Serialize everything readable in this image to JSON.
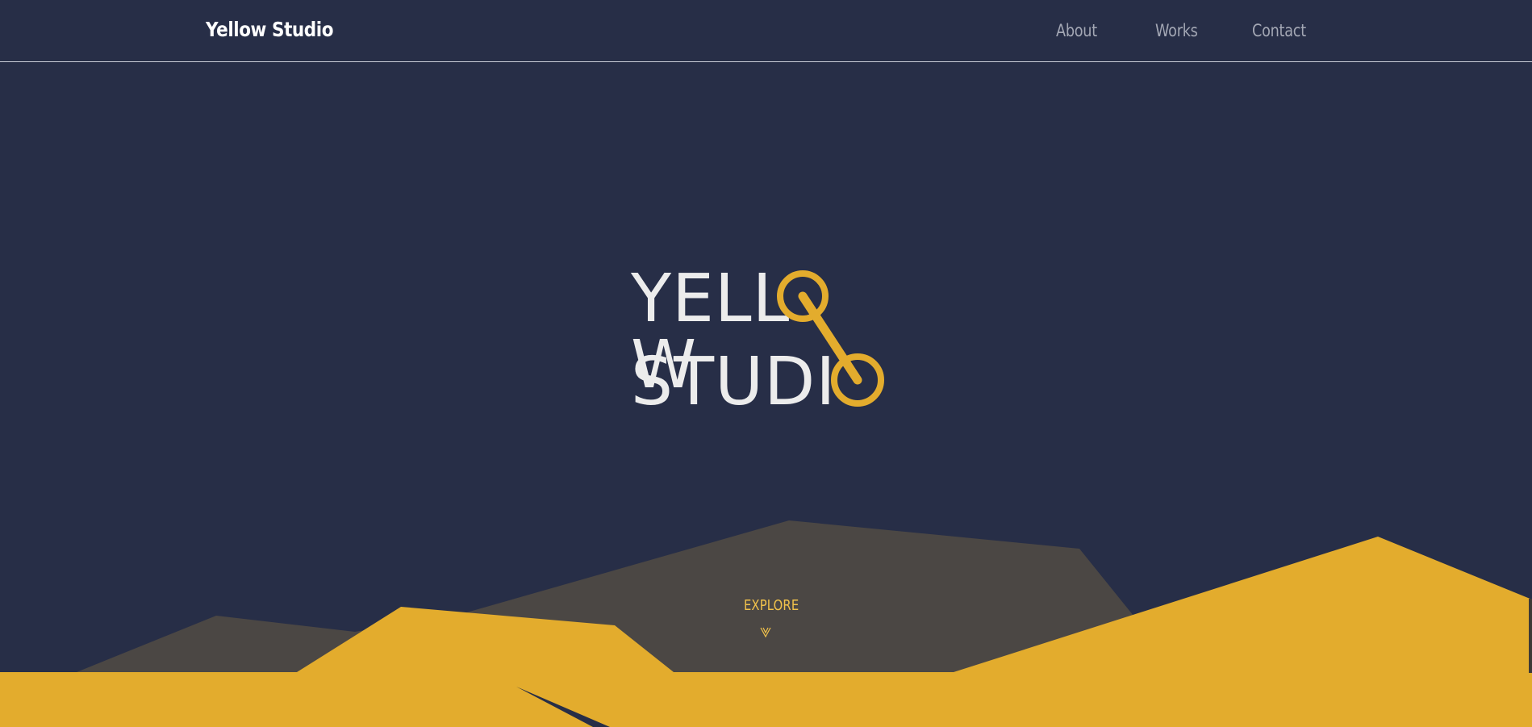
{
  "header": {
    "brand": "Yellow Studio",
    "nav": [
      {
        "label": "About"
      },
      {
        "label": "Works"
      },
      {
        "label": "Contact"
      }
    ]
  },
  "hero": {
    "logo_line_1": "YELL",
    "logo_line_1_end": "W",
    "logo_line_2": "STUDI",
    "accent_color": "#e3ac2d",
    "text_color": "#ececec"
  },
  "explore": {
    "label": "EXPLORE",
    "icon": "chevron-down-icon"
  },
  "colors": {
    "background": "#272e47",
    "mountain_dark": "#4b4744",
    "mountain_yellow": "#e3ac2d"
  }
}
